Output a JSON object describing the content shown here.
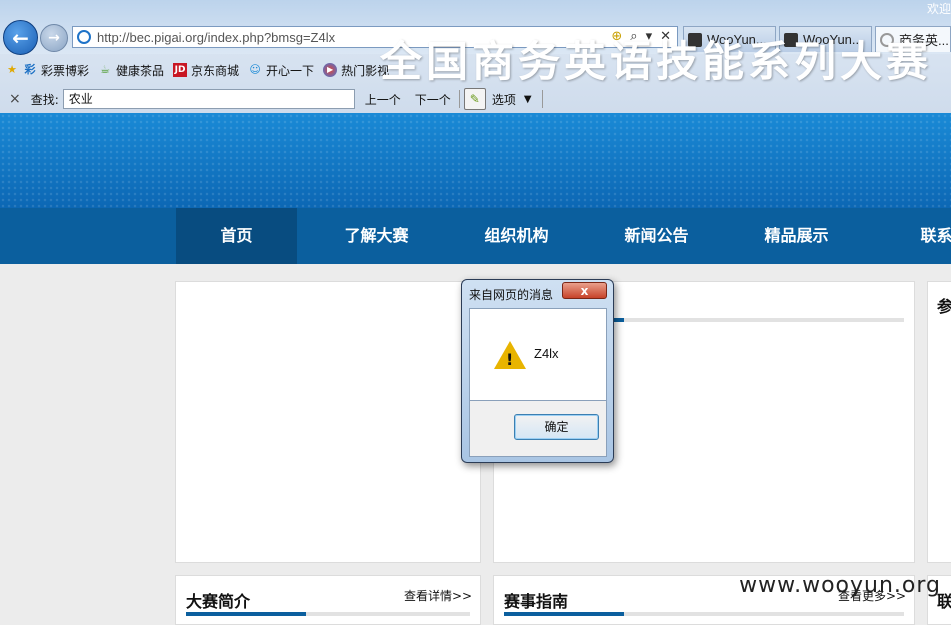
{
  "browser": {
    "address_url": "http://bec.pigai.org/index.php?bmsg=Z4lx",
    "tabs": [
      {
        "label": "WooYun..."
      },
      {
        "label": "WooYun..."
      },
      {
        "label": "商务英..."
      }
    ],
    "favorites": [
      {
        "label": "彩票博彩",
        "icon": "彩"
      },
      {
        "label": "健康茶品",
        "icon": "tea-icon"
      },
      {
        "label": "京东商城",
        "icon": "JD"
      },
      {
        "label": "开心一下",
        "icon": "smile-icon"
      },
      {
        "label": "热门影视",
        "icon": "play-icon"
      }
    ],
    "find": {
      "close": "×",
      "label": "查找:",
      "value": "农业",
      "prev": "上一个",
      "next": "下一个",
      "options": "选项"
    }
  },
  "page": {
    "welcome": "欢迎",
    "site_title": "全国商务英语技能系列大赛",
    "nav": [
      "首页",
      "了解大赛",
      "组织机构",
      "新闻公告",
      "精品展示",
      "联系"
    ],
    "right_panel_head": "参",
    "sections": {
      "intro": {
        "title": "大赛简介",
        "more": "查看详情>>"
      },
      "guide": {
        "title": "赛事指南",
        "more": "查看更多>>"
      },
      "contact": {
        "title": "联"
      }
    },
    "watermark": "www.wooyun.org"
  },
  "dialog": {
    "title": "来自网页的消息",
    "close": "x",
    "message": "Z4lx",
    "ok": "确定"
  }
}
